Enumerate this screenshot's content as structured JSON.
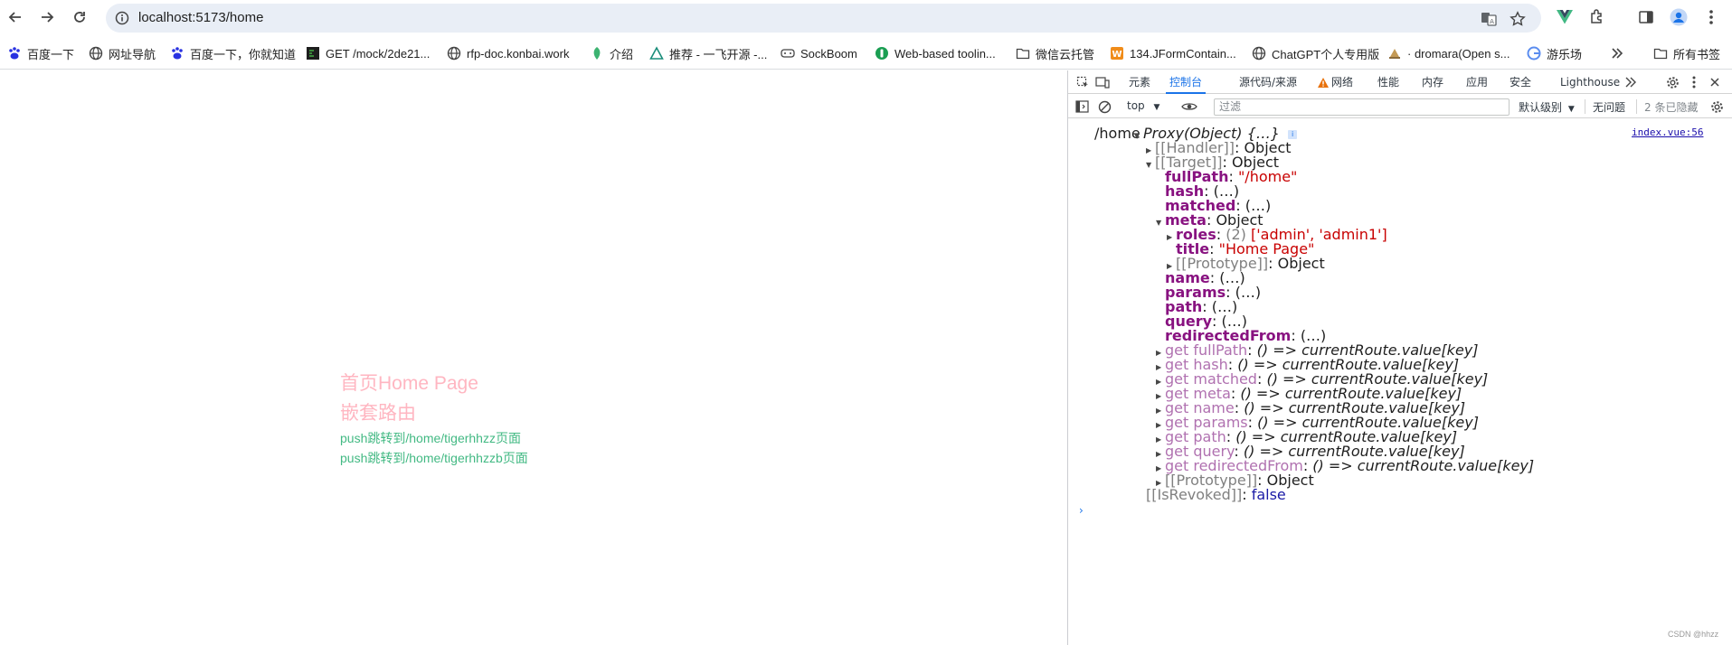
{
  "browser": {
    "url": "localhost:5173/home",
    "bookmarks": [
      "百度一下",
      "网址导航",
      "百度一下，你就知道",
      "GET /mock/2de21...",
      "rfp-doc.konbai.work",
      "介绍",
      "推荐 - 一飞开源 -...",
      "SockBoom",
      "Web-based toolin...",
      "微信云托管",
      "134.JFormContain...",
      "ChatGPT个人专用版",
      "· dromara(Open s...",
      "游乐场",
      "所有书签"
    ]
  },
  "page": {
    "home_title": "首页Home Page",
    "nested_title": "嵌套路由",
    "link1": "push跳转到/home/tigerhhzz页面",
    "link2": "push跳转到/home/tigerhhzzb页面"
  },
  "devtools": {
    "tabs": [
      "元素",
      "控制台",
      "源代码/来源",
      "网络",
      "性能",
      "内存",
      "应用",
      "安全",
      "Lighthouse"
    ],
    "active_tab": "控制台",
    "toolbar": {
      "context": "top",
      "filter_placeholder": "过滤",
      "level": "默认级别",
      "issues": "无问题",
      "hidden": "2 条已隐藏"
    },
    "source_link": "index.vue:56",
    "log_prefix": "/home",
    "lines": {
      "proxy": "Proxy(Object) {…}",
      "handler": "[[Handler]]",
      "handler_val": "Object",
      "target": "[[Target]]",
      "target_val": "Object",
      "fullPath_key": "fullPath",
      "fullPath_val": "\"/home\"",
      "hash_key": "hash",
      "matched_key": "matched",
      "meta_key": "meta",
      "meta_val": "Object",
      "roles_key": "roles",
      "roles_count": "(2)",
      "roles_val": "['admin', 'admin1']",
      "title_key": "title",
      "title_val": "\"Home Page\"",
      "proto": "[[Prototype]]",
      "proto_val": "Object",
      "name_key": "name",
      "params_key": "params",
      "path_key": "path",
      "query_key": "query",
      "redirectedFrom_key": "redirectedFrom",
      "lazy": "(…)",
      "getters": [
        {
          "key": "get fullPath",
          "val": "() => currentRoute.value[key]"
        },
        {
          "key": "get hash",
          "val": "() => currentRoute.value[key]"
        },
        {
          "key": "get matched",
          "val": "() => currentRoute.value[key]"
        },
        {
          "key": "get meta",
          "val": "() => currentRoute.value[key]"
        },
        {
          "key": "get name",
          "val": "() => currentRoute.value[key]"
        },
        {
          "key": "get params",
          "val": "() => currentRoute.value[key]"
        },
        {
          "key": "get path",
          "val": "() => currentRoute.value[key]"
        },
        {
          "key": "get query",
          "val": "() => currentRoute.value[key]"
        },
        {
          "key": "get redirectedFrom",
          "val": "() => currentRoute.value[key]"
        }
      ],
      "outer_proto": "[[Prototype]]",
      "outer_proto_val": "Object",
      "revoked": "[[IsRevoked]]",
      "revoked_val": "false"
    }
  },
  "watermark": "CSDN @hhzz"
}
